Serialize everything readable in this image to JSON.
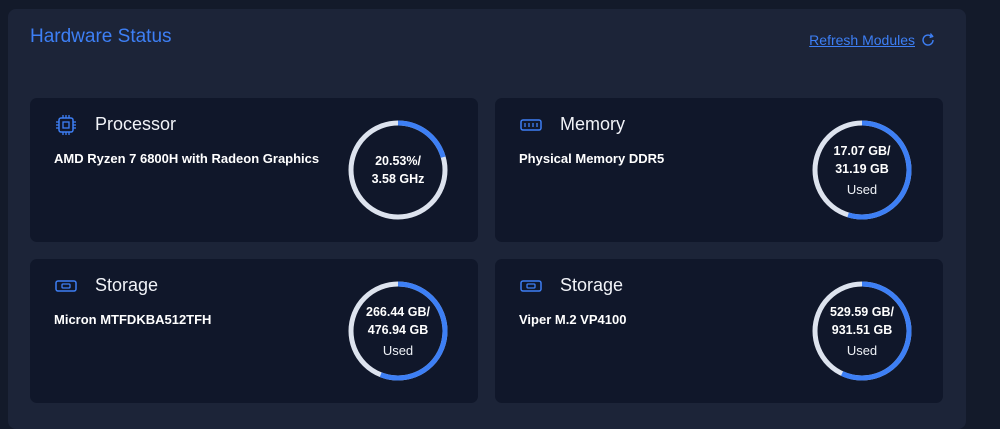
{
  "panel": {
    "title": "Hardware Status",
    "refresh_label": "Refresh Modules"
  },
  "colors": {
    "accent": "#3d7ff5",
    "ring_track": "#dde3ee",
    "card_bg": "#10172a",
    "panel_bg": "#1c2438"
  },
  "cards": [
    {
      "icon": "cpu-icon",
      "title": "Processor",
      "subtitle": "AMD Ryzen 7 6800H with Radeon Graphics",
      "value_line1": "20.53%/",
      "value_line2": "3.58 GHz",
      "used_label": "",
      "usage_fraction": 0.2053
    },
    {
      "icon": "memory-icon",
      "title": "Memory",
      "subtitle": "Physical Memory DDR5",
      "value_line1": "17.07 GB/",
      "value_line2": "31.19 GB",
      "used_label": "Used",
      "usage_fraction": 0.547
    },
    {
      "icon": "storage-icon",
      "title": "Storage",
      "subtitle": "Micron MTFDKBA512TFH",
      "value_line1": "266.44 GB/",
      "value_line2": "476.94 GB",
      "used_label": "Used",
      "usage_fraction": 0.559
    },
    {
      "icon": "storage-icon",
      "title": "Storage",
      "subtitle": "Viper M.2 VP4100",
      "value_line1": "529.59 GB/",
      "value_line2": "931.51 GB",
      "used_label": "Used",
      "usage_fraction": 0.569
    }
  ]
}
